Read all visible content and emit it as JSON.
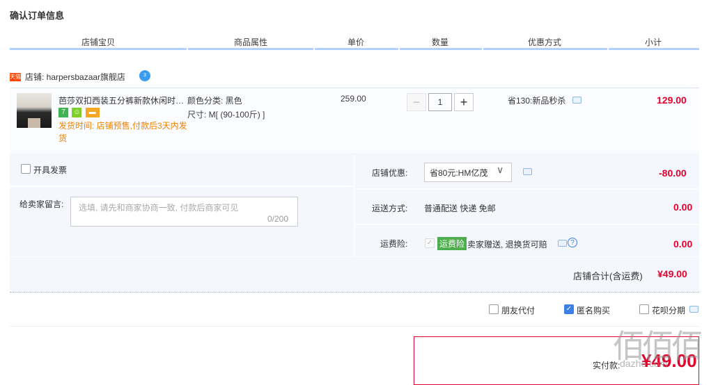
{
  "page_title": "确认订单信息",
  "columns": [
    "店铺宝贝",
    "商品属性",
    "单价",
    "数量",
    "优惠方式",
    "小计"
  ],
  "shop": {
    "tag": "天猫",
    "label": "店铺: harpersbazaar旗舰店",
    "chat_badge": "3"
  },
  "item": {
    "title": "芭莎双扣西装五分裤新款休闲时…",
    "badges": [
      "7",
      "☺",
      "▬"
    ],
    "shipping_note": "发货时间: 店铺预售,付款后3天内发货",
    "attr_color": "颜色分类: 黑色",
    "attr_size": "尺寸: M[ (90-100斤) ]",
    "unit_price": "259.00",
    "qty_minus": "−",
    "quantity": "1",
    "qty_plus": "+",
    "promotion": "省130:新品秒杀",
    "subtotal": "129.00"
  },
  "invoice": {
    "label": "开具发票"
  },
  "message": {
    "label": "给卖家留言:",
    "placeholder": "选填, 请先和商家协商一致, 付款后商家可见",
    "count": "0/200"
  },
  "shop_discount": {
    "label": "店铺优惠:",
    "selected": "省80元:HM亿茂",
    "arrow": "∨",
    "amount": "-80.00"
  },
  "shipping": {
    "label": "运送方式:",
    "value": "普通配送 快递 免邮",
    "amount": "0.00"
  },
  "insurance": {
    "label": "运费险:",
    "tag": "运费险",
    "text": "卖家赠送, 退换货可赔",
    "help": "?",
    "amount": "0.00"
  },
  "total": {
    "label": "店铺合计(含运费)",
    "amount": "¥49.00"
  },
  "options": {
    "friend_pay": "朋友代付",
    "anonymous": "匿名购买",
    "huabei": "花呗分期"
  },
  "payment": {
    "label": "实付款:",
    "amount": "¥49.00"
  },
  "watermark": {
    "logo": "佰佰佰",
    "site": "dazhe.com"
  },
  "colors": {
    "accent_red": "#e4002b",
    "header_bar": "#b2d1ff",
    "panel_bg": "#f4f7fd",
    "checked_blue": "#3c7fe5",
    "insurance_green": "#4cae4c",
    "ship_orange": "#f08200"
  }
}
